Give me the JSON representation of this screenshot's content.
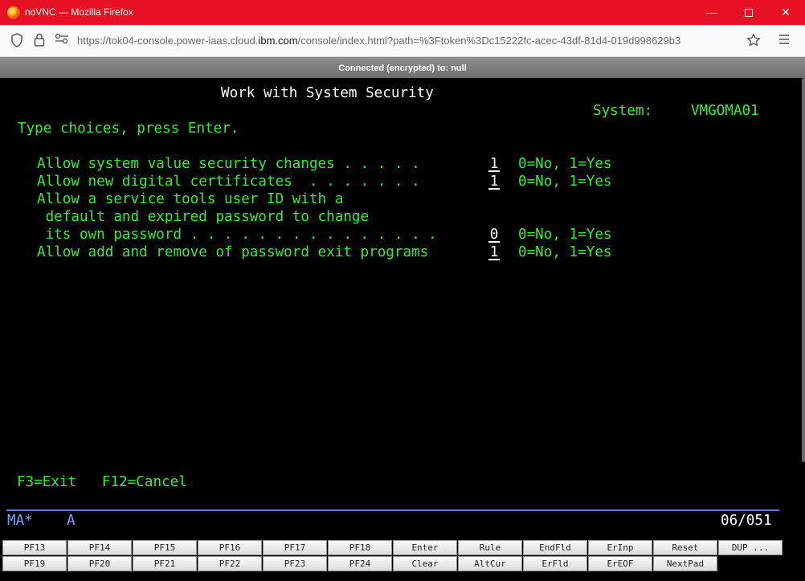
{
  "window": {
    "title": "noVNC — Mozilla Firefox",
    "minimize": "—",
    "maximize": "",
    "close": "✕"
  },
  "navbar": {
    "url_prefix": "https://tok04-console.power-iaas.cloud.",
    "url_domain": "ibm.com",
    "url_suffix": "/console/index.html?path=%3Ftoken%3Dc15222fc-acec-43df-81d4-019d998629b3",
    "shield_icon": "shield-icon",
    "lock_icon": "lock-icon",
    "permissions_icon": "permissions-icon",
    "bookmark_icon": "star-icon",
    "menu_icon": "hamburger-menu-icon"
  },
  "vnc": {
    "status": "Connected (encrypted) to: null"
  },
  "screen": {
    "title": "Work with System Security",
    "system_label": "System:",
    "system_name": "VMGOMA01",
    "instruction": "Type choices, press Enter.",
    "options": [
      {
        "label": "Allow system value security changes . . . . .",
        "value": "1",
        "hint": "0=No, 1=Yes"
      },
      {
        "label": "Allow new digital certificates  . . . . . . .",
        "value": "1",
        "hint": "0=No, 1=Yes"
      },
      {
        "label_line1": "Allow a service tools user ID with a",
        "label_line2": " default and expired password to change",
        "label": " its own password . . . . . . . . . . . . . . .",
        "value": "0",
        "hint": "0=No, 1=Yes"
      },
      {
        "label": "Allow add and remove of password exit programs",
        "value": "1",
        "hint": "0=No, 1=Yes"
      }
    ],
    "fkeys": "F3=Exit   F12=Cancel"
  },
  "oia": {
    "left": "MA*",
    "mode": "A",
    "cursor": "06/051"
  },
  "keypad": {
    "row1": [
      "PF13",
      "PF14",
      "PF15",
      "PF16",
      "PF17",
      "PF18",
      "Enter",
      "Rule",
      "EndFld",
      "ErInp",
      "Reset",
      "DUP ..."
    ],
    "row2": [
      "PF19",
      "PF20",
      "PF21",
      "PF22",
      "PF23",
      "PF24",
      "Clear",
      "AltCur",
      "ErFld",
      "ErEOF",
      "NextPad"
    ]
  }
}
